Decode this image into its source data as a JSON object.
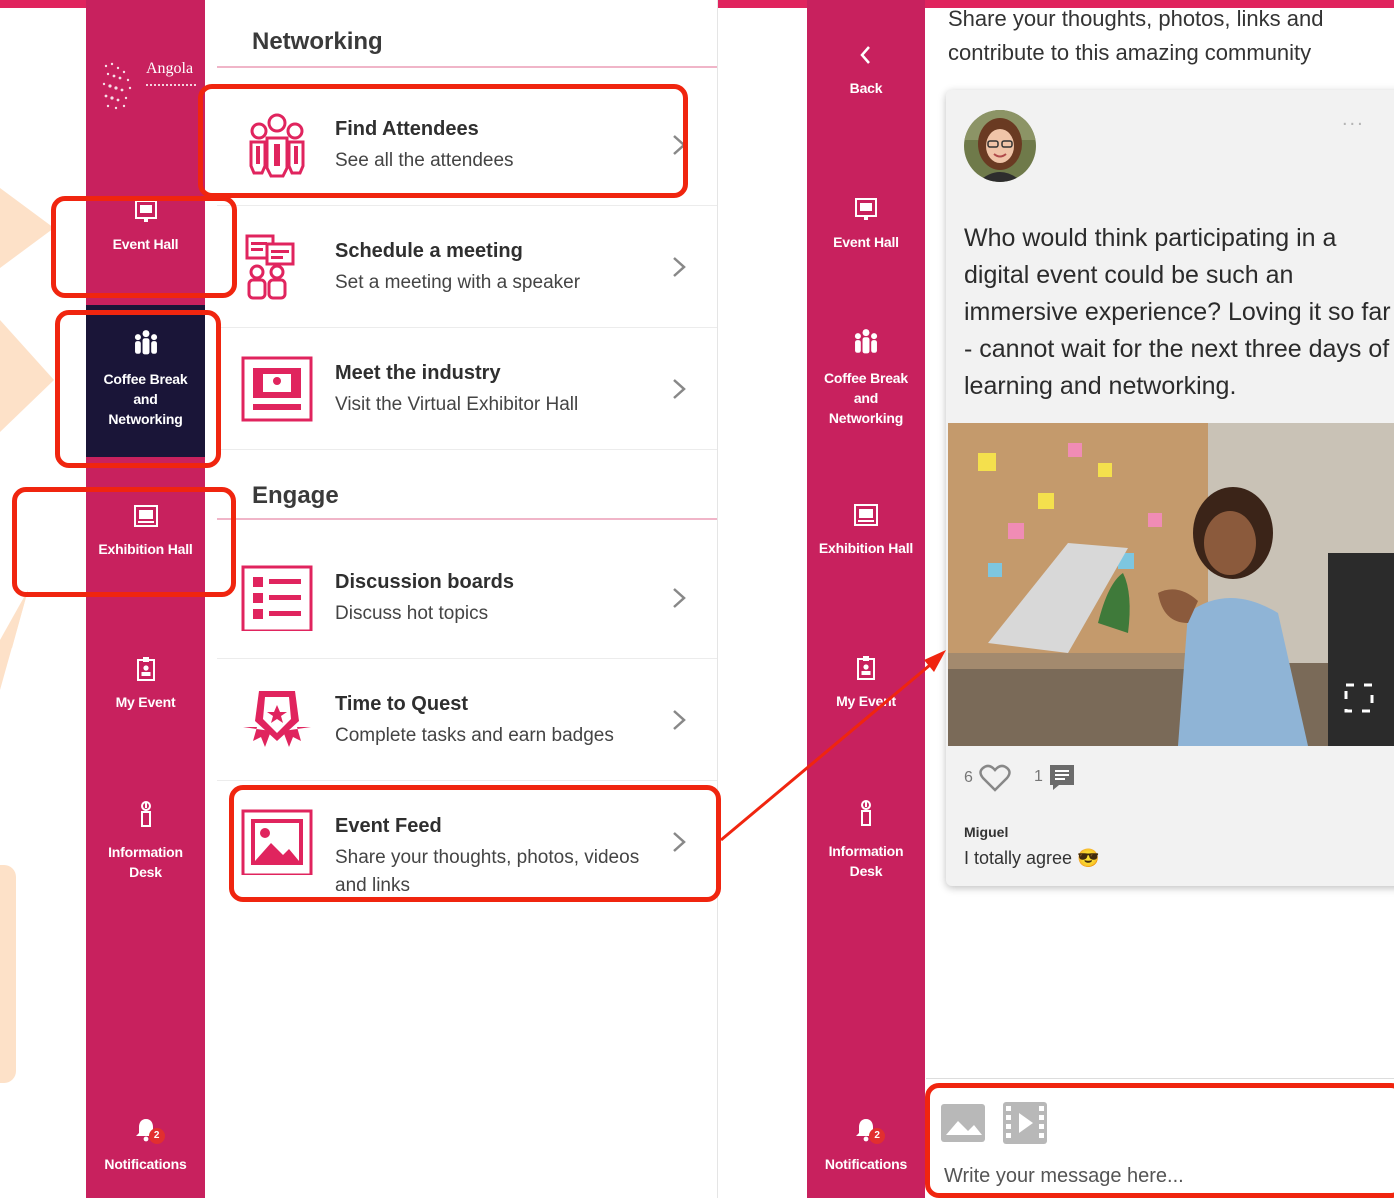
{
  "sidebar_left": {
    "logo_text": "Angola",
    "items": [
      {
        "label": "Event Hall"
      },
      {
        "label": "Coffee Break and Networking"
      },
      {
        "label": "Exhibition Hall"
      },
      {
        "label": "My Event"
      },
      {
        "label": "Information Desk"
      },
      {
        "label": "Notifications",
        "badge": "2"
      }
    ]
  },
  "sidebar_right": {
    "back_label": "Back",
    "items": [
      {
        "label": "Event Hall"
      },
      {
        "label": "Coffee Break and Networking"
      },
      {
        "label": "Exhibition Hall"
      },
      {
        "label": "My Event"
      },
      {
        "label": "Information Desk"
      },
      {
        "label": "Notifications",
        "badge": "2"
      }
    ]
  },
  "menu": {
    "networking_title": "Networking",
    "engage_title": "Engage",
    "rows": [
      {
        "title": "Find Attendees",
        "subtitle": "See all the attendees"
      },
      {
        "title": "Schedule a meeting",
        "subtitle": "Set a meeting with a speaker"
      },
      {
        "title": "Meet the industry",
        "subtitle": "Visit the Virtual Exhibitor Hall"
      },
      {
        "title": "Discussion boards",
        "subtitle": "Discuss hot topics"
      },
      {
        "title": "Time to Quest",
        "subtitle": "Complete tasks and earn badges"
      },
      {
        "title": "Event Feed",
        "subtitle": "Share your thoughts, photos, videos and links"
      }
    ]
  },
  "feed": {
    "intro": "Share your thoughts, photos, links and contribute to this amazing community",
    "post": {
      "text": "Who would think participating in a digital event could be such an immersive experience? Loving it so far - cannot wait for the next three days of learning and networking.",
      "more": "...",
      "likes": "6",
      "comments": "1",
      "commenter": "Miguel",
      "comment": "I totally agree 😎"
    },
    "composer_placeholder": "Write your message here..."
  },
  "colors": {
    "brand": "#c8215e",
    "accent": "#e0245e",
    "active_nav": "#1a1538",
    "highlight": "#f0250f",
    "callout": "#fde1c8"
  }
}
